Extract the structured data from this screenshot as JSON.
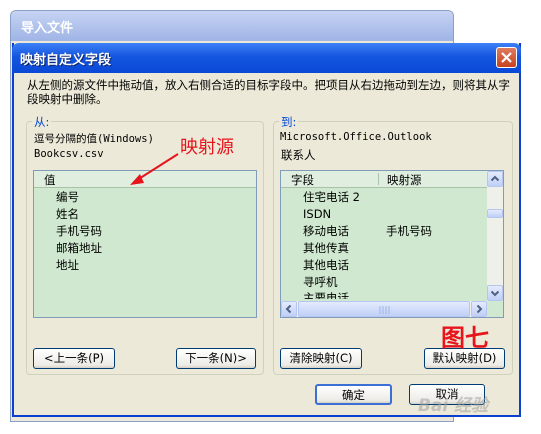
{
  "background_window": {
    "title": "导入文件"
  },
  "dialog": {
    "title": "映射自定义字段",
    "description": "从左侧的源文件中拖动值，放入右侧合适的目标字段中。把项目从右边拖动到左边，则将其从字段映射中删除。"
  },
  "from_panel": {
    "label": "从:",
    "source_type": "逗号分隔的值(Windows)",
    "source_file": "Bookcsv.csv",
    "column_header": "值",
    "items": [
      "编号",
      "姓名",
      "手机号码",
      "邮箱地址",
      "地址"
    ],
    "prev_button": "<上一条(P)",
    "next_button": "下一条(N)>"
  },
  "to_panel": {
    "label": "到:",
    "target_app": "Microsoft.Office.Outlook",
    "target_folder": "联系人",
    "columns": [
      "字段",
      "映射源"
    ],
    "rows": [
      {
        "field": "住宅电话 2",
        "source": ""
      },
      {
        "field": "ISDN",
        "source": ""
      },
      {
        "field": "移动电话",
        "source": "手机号码"
      },
      {
        "field": "其他传真",
        "source": ""
      },
      {
        "field": "其他电话",
        "source": ""
      },
      {
        "field": "寻呼机",
        "source": ""
      },
      {
        "field": "主要电话",
        "source": ""
      }
    ],
    "clear_button": "清除映射(C)",
    "default_button": "默认映射(D)"
  },
  "footer": {
    "ok_button": "确定",
    "cancel_button": "取消"
  },
  "annotations": {
    "arrow_label": "映射源",
    "figure_label": "图七",
    "watermark": "Bai 经验"
  },
  "colors": {
    "titlebar": "#0a48d6",
    "list_bg": "#cfe8cf",
    "annotation": "#e8141c"
  }
}
